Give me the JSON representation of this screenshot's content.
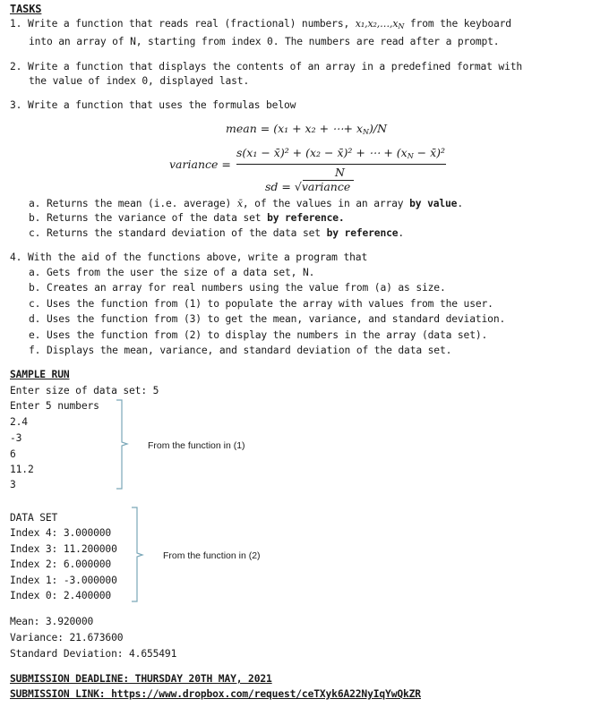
{
  "heading": "TASKS",
  "task1": {
    "num": "1.",
    "line1_pre": "Write a function that reads real (fractional) numbers, ",
    "vars": "x₁,x₂,…,x",
    "vars_sub": "N",
    "line1_post": " from the keyboard",
    "line2": "into an array of N, starting from index 0. The numbers are read after a prompt."
  },
  "task2": {
    "num": "2.",
    "line1": "Write a function that displays the contents of an array in a predefined format with",
    "line2": "the value of index 0, displayed last."
  },
  "task3": {
    "num": "3.",
    "line1": "Write a function that uses the formulas below",
    "formulas": {
      "mean_lhs": "mean =",
      "mean_rhs": "(x₁ + x₂ + ⋯+ x",
      "mean_rhs_sub": "N",
      "mean_rhs_end": ")/N",
      "variance_lhs": "variance =",
      "variance_numerator": "s(x₁ − x̄)² + (x₂ − x̄)² + ⋯ + (x",
      "variance_numerator_sub": "N",
      "variance_numerator_end": " − x̄)²",
      "variance_denominator": "N",
      "sd_lhs": "sd =",
      "sd_radical": "√",
      "sd_rhs": "variance"
    },
    "items": [
      {
        "label": "a.",
        "text": "Returns the mean (i.e. average) ",
        "mathvar": "x̄",
        "text2": ", of the values in an array ",
        "bold": "by value",
        "end": "."
      },
      {
        "label": "b.",
        "text": "Returns the variance of the data set ",
        "bold": "by reference.",
        "end": ""
      },
      {
        "label": "c.",
        "text": "Returns the standard deviation of the data set ",
        "bold": "by reference",
        "end": "."
      }
    ]
  },
  "task4": {
    "num": "4.",
    "line1": "With the aid of the functions above, write a program that",
    "items": [
      {
        "label": "a.",
        "text": "Gets from the user the size of a data set, N."
      },
      {
        "label": "b.",
        "text": "Creates an array for real numbers using the value from (a) as size."
      },
      {
        "label": "c.",
        "text": "Uses the function from (1) to populate the array with values from the user."
      },
      {
        "label": "d.",
        "text": "Uses the function from (3) to get the mean, variance, and standard deviation."
      },
      {
        "label": "e.",
        "text": "Uses the function from (2) to display the numbers in the array (data set)."
      },
      {
        "label": "f.",
        "text": "Displays the mean, variance, and standard deviation of the data set."
      }
    ]
  },
  "sample_run": {
    "heading": "SAMPLE RUN",
    "input_lines": [
      "Enter size of data set: 5",
      "Enter 5 numbers",
      "2.4",
      "-3",
      "6",
      "11.2",
      "3"
    ],
    "annotation1": "From the function in (1)",
    "dataset_lines": [
      "DATA SET",
      "Index 4: 3.000000",
      "Index 3: 11.200000",
      "Index 2: 6.000000",
      "Index 1: -3.000000",
      "Index 0: 2.400000"
    ],
    "annotation2": "From the function in (2)",
    "result_lines": [
      "Mean: 3.920000",
      "Variance: 21.673600",
      "Standard Deviation: 4.655491"
    ]
  },
  "submission": {
    "deadline": "SUBMISSION DEADLINE: THURSDAY 20TH MAY, 2021",
    "link_label": "SUBMISSION LINK: ",
    "link_url": "https://www.dropbox.com/request/ceTXyk6A22NyIqYwQkZR"
  },
  "colors": {
    "text": "#1a1a1a",
    "brace": "#7aa7b8"
  }
}
